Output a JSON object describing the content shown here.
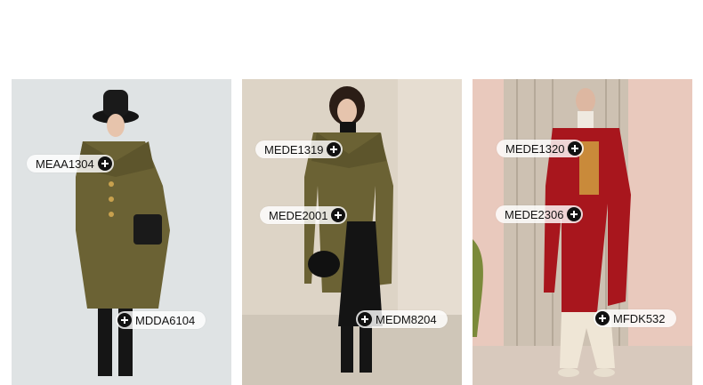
{
  "looks": [
    {
      "tags": [
        "MEAA1304",
        "MDDA6104"
      ]
    },
    {
      "tags": [
        "MEDE1319",
        "MEDE2001",
        "MEDM8204"
      ]
    },
    {
      "tags": [
        "MEDE1320",
        "MEDE2306",
        "MFDK532"
      ]
    }
  ],
  "colors": {
    "olive_coat": "#6b6234",
    "red_coat": "#a8161d",
    "tag_bg": "#ffffff",
    "plus_icon": "#111111"
  }
}
